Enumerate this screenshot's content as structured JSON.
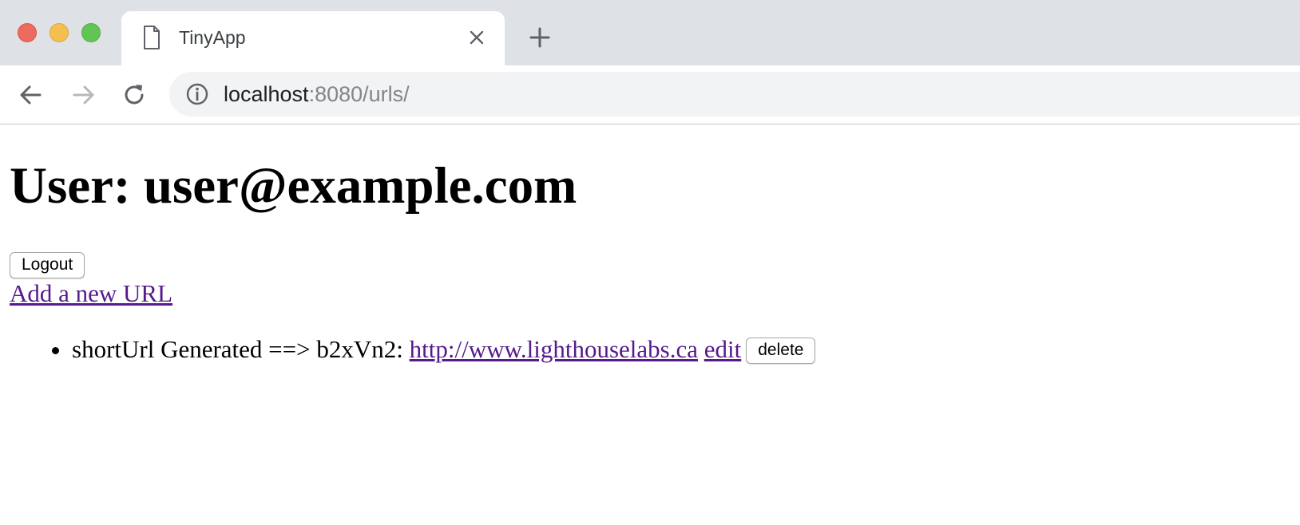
{
  "browser": {
    "tab_title": "TinyApp",
    "url_host": "localhost",
    "url_rest": ":8080/urls/",
    "icons": [
      "document-icon",
      "close-icon",
      "plus-icon",
      "back-arrow-icon",
      "forward-arrow-icon",
      "reload-icon",
      "info-icon"
    ]
  },
  "page": {
    "heading": "User: user@example.com",
    "logout_label": "Logout",
    "add_url_label": "Add a new URL",
    "urls": [
      {
        "prefix": "shortUrl Generated ==> b2xVn2: ",
        "long_url": "http://www.lighthouselabs.ca",
        "edit_label": "edit",
        "delete_label": "delete"
      }
    ]
  },
  "colors": {
    "chrome_bg": "#dee1e6",
    "omnibox_bg": "#f1f3f4",
    "visited_link": "#551a8b"
  }
}
